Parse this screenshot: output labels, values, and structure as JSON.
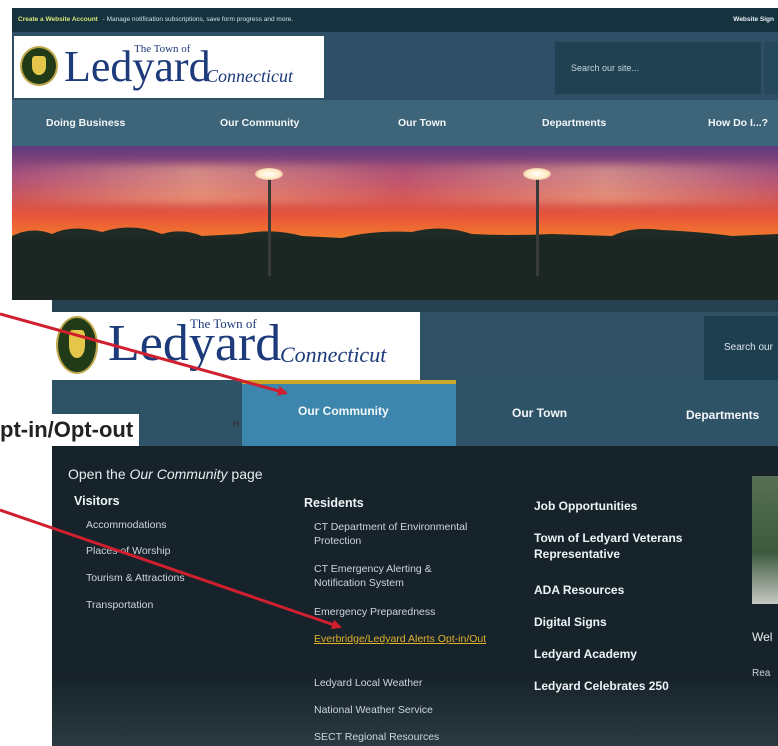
{
  "top_screenshot": {
    "utility_bar": {
      "link": "Create a Website Account",
      "text": "- Manage notification subscriptions, save form progress and more.",
      "sign_in": "Website Sign"
    },
    "logo": {
      "the_town_of": "The Town of",
      "name": "Ledyard",
      "state": "Connecticut"
    },
    "search_placeholder": "Search our site...",
    "nav": [
      "Doing Business",
      "Our Community",
      "Our Town",
      "Departments",
      "How Do I...?"
    ]
  },
  "bottom_screenshot": {
    "logo": {
      "the_town_of": "The Town of",
      "name": "Ledyard",
      "state": "Connecticut"
    },
    "search_label": "Search our",
    "nav": {
      "active": "Our Community",
      "items": [
        "Our Town",
        "Departments"
      ]
    },
    "mega_menu": {
      "open_page_prefix": "Open the ",
      "open_page_name": "Our Community",
      "open_page_suffix": " page",
      "visitors": {
        "heading": "Visitors",
        "items": [
          "Accommodations",
          "Places of Worship",
          "Tourism & Attractions",
          "Transportation"
        ]
      },
      "residents": {
        "heading": "Residents",
        "items": [
          "CT Department of Environmental Protection",
          "CT Emergency Alerting & Notification System",
          "Emergency Preparedness",
          "Everbridge/Ledyard Alerts Opt-in/Out",
          "Ledyard Local Weather",
          "National Weather Service",
          "SECT Regional Resources"
        ]
      },
      "jobs": [
        "Job Opportunities",
        "Town of Ledyard Veterans Representative",
        "ADA Resources",
        "Digital Signs",
        "Ledyard Academy",
        "Ledyard Celebrates 250"
      ],
      "side_title": "Wel",
      "side_read": "Rea"
    }
  },
  "callout": {
    "text": "pt-in/Opt-out",
    "close_quote": "”"
  },
  "colors": {
    "arrow": "#d01f2e",
    "highlight_link": "#e2b22d",
    "active_tab": "#3c86ae",
    "active_tab_border": "#c9a72a"
  }
}
